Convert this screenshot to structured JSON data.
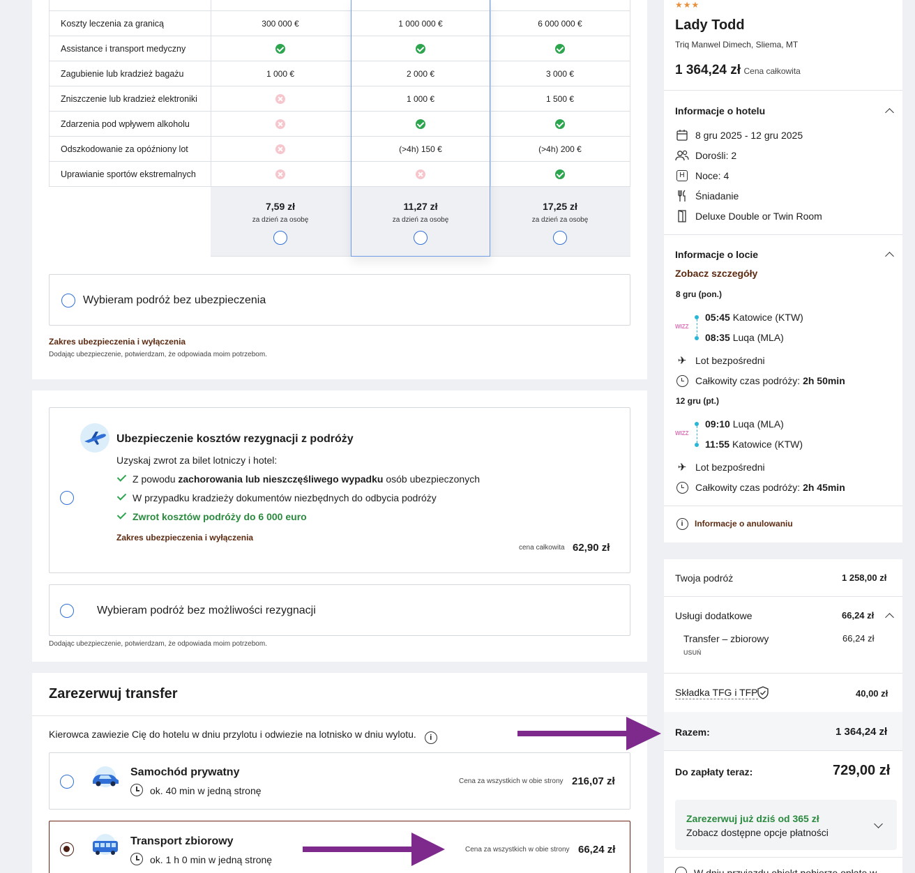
{
  "insurance_table": {
    "rows": [
      {
        "label": "Koszty leczenia za granicą",
        "cells": [
          "300 000 €",
          "1 000 000 €",
          "6 000 000 €"
        ]
      },
      {
        "label": "Assistance i transport medyczny",
        "cells": [
          "ok",
          "ok",
          "ok"
        ]
      },
      {
        "label": "Zagubienie lub kradzież bagażu",
        "cells": [
          "1 000 €",
          "2 000 €",
          "3 000 €"
        ]
      },
      {
        "label": "Zniszczenie lub kradzież elektroniki",
        "cells": [
          "no",
          "1 000 €",
          "1 500 €"
        ]
      },
      {
        "label": "Zdarzenia pod wpływem alkoholu",
        "cells": [
          "no",
          "ok",
          "ok"
        ]
      },
      {
        "label": "Odszkodowanie za opóźniony lot",
        "cells": [
          "no",
          "(>4h) 150 €",
          "(>4h) 200 €"
        ]
      },
      {
        "label": "Uprawianie sportów ekstremalnych",
        "cells": [
          "no",
          "no",
          "ok"
        ]
      }
    ],
    "prices": [
      {
        "price": "7,59 zł",
        "unit": "za dzień za osobę"
      },
      {
        "price": "11,27 zł",
        "unit": "za dzień za osobę"
      },
      {
        "price": "17,25 zł",
        "unit": "za dzień za osobę"
      }
    ],
    "no_insurance_label": "Wybieram podróż bez ubezpieczenia",
    "scope_link": "Zakres ubezpieczenia i wyłączenia",
    "disclaimer": "Dodając ubezpieczenie, potwierdzam, że odpowiada moim potrzebom."
  },
  "cancellation": {
    "title": "Ubezpieczenie kosztów rezygnacji z podróży",
    "intro": "Uzyskaj zwrot za bilet lotniczy i hotel:",
    "bullet1_pre": "Z powodu ",
    "bullet1_bold": "zachorowania lub nieszczęśliwego wypadku",
    "bullet1_post": " osób ubezpieczonych",
    "bullet2": "W przypadku kradzieży dokumentów niezbędnych do odbycia podróży",
    "bullet3": "Zwrot kosztów podróży do 6 000 euro",
    "scope_link": "Zakres ubezpieczenia i wyłączenia",
    "price_label": "cena całkowita",
    "price": "62,90 zł",
    "no_cancel_label": "Wybieram podróż bez możliwości rezygnacji",
    "disclaimer": "Dodając ubezpieczenie, potwierdzam, że odpowiada moim potrzebom."
  },
  "transfer": {
    "title": "Zarezerwuj transfer",
    "intro": "Kierowca zawiezie Cię do hotelu w dniu przylotu i odwiezie na lotnisko w dniu wylotu.",
    "options": [
      {
        "name": "Samochód prywatny",
        "duration": "ok. 40 min w jedną stronę",
        "price_label": "Cena za wszystkich w obie strony",
        "price": "216,07 zł"
      },
      {
        "name": "Transport zbiorowy",
        "duration": "ok. 1 h 0 min w jedną stronę",
        "price_label": "Cena za wszystkich w obie strony",
        "price": "66,24 zł"
      }
    ]
  },
  "hotel": {
    "stars": "★★★",
    "name": "Lady Todd",
    "address": "Triq Manwel Dimech, Sliema, MT",
    "price": "1 364,24 zł",
    "price_label": "Cena całkowita"
  },
  "hotel_info": {
    "title": "Informacje o hotelu",
    "dates": "8 gru 2025 - 12 gru 2025",
    "adults": "Dorośli: 2",
    "nights": "Noce: 4",
    "board": "Śniadanie",
    "room": "Deluxe Double or Twin Room"
  },
  "flight_info": {
    "title": "Informacje o locie",
    "details_link": "Zobacz szczegóły",
    "airline_logo": "WIZZ",
    "outbound": {
      "date": "8 gru (pon.)",
      "dep_time": "05:45",
      "dep_place": "Katowice (KTW)",
      "arr_time": "08:35",
      "arr_place": "Luqa (MLA)",
      "direct": "Lot bezpośredni",
      "duration_label": "Całkowity czas podróży: ",
      "duration": "2h 50min"
    },
    "inbound": {
      "date": "12 gru (pt.)",
      "dep_time": "09:10",
      "dep_place": "Luqa (MLA)",
      "arr_time": "11:55",
      "arr_place": "Katowice (KTW)",
      "direct": "Lot bezpośredni",
      "duration_label": "Całkowity czas podróży: ",
      "duration": "2h 45min"
    },
    "cancel_link": "Informacje o anulowaniu"
  },
  "summary": {
    "trip_label": "Twoja podróż",
    "trip_value": "1 258,00 zł",
    "extras_label": "Usługi dodatkowe",
    "extras_value": "66,24 zł",
    "transfer_label": "Transfer – zbiorowy",
    "transfer_value": "66,24 zł",
    "remove_label": "USUŃ",
    "tfg_label": "Składka TFG i TFP",
    "tfg_value": "40,00 zł",
    "total_label": "Razem:",
    "total_value": "1 364,24 zł",
    "pay_now_label": "Do zapłaty teraz:",
    "pay_now_value": "729,00 zł",
    "promo_title": "Zarezerwuj już dziś od 365 zł",
    "promo_sub": "Zobacz dostępne opcje płatności",
    "footer_partial": "W dniu przyjazdu obiekt pobierze opłatę w"
  },
  "colors": {
    "accent_brown": "#5c2a10",
    "green": "#2da44e",
    "blue": "#2f6fd6",
    "arrow": "#7d2a8c"
  }
}
